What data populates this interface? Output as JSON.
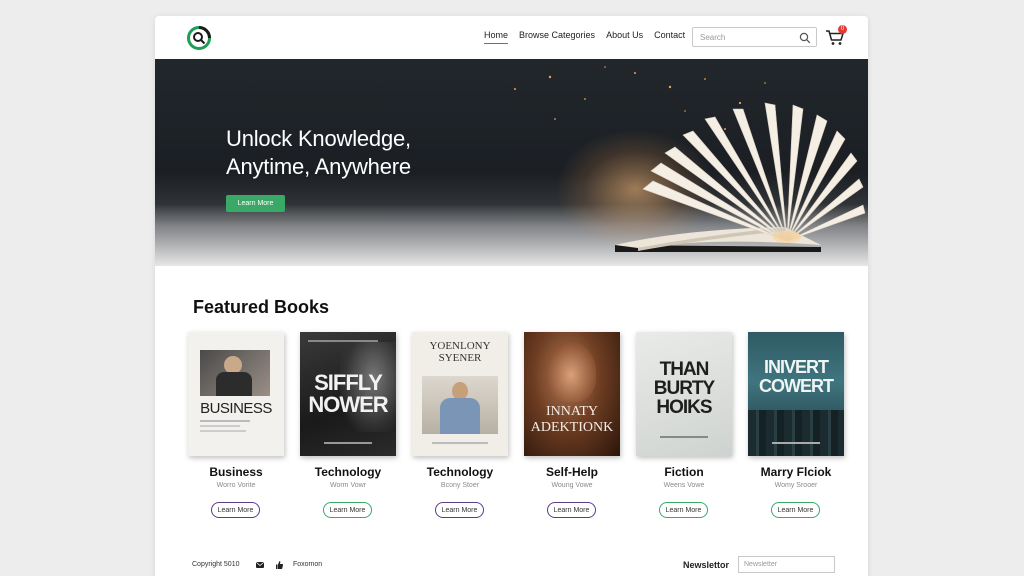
{
  "header": {
    "nav": [
      {
        "label": "Home",
        "active": true
      },
      {
        "label": "Browse Categories",
        "active": false
      },
      {
        "label": "About Us",
        "active": false
      },
      {
        "label": "Contact",
        "active": false
      }
    ],
    "search_placeholder": "Search",
    "cart_count": "0"
  },
  "hero": {
    "title_line1": "Unlock Knowledge,",
    "title_line2": "Anytime, Anywhere",
    "button_label": "Learn More"
  },
  "featured": {
    "title": "Featured Books",
    "books": [
      {
        "cover_text": "BUSINESS",
        "category": "Business",
        "author": "Worro Vorite",
        "button_label": "Learn More",
        "button_color": "#5b3d8a"
      },
      {
        "cover_text_line1": "SIFFLY",
        "cover_text_line2": "NOWER",
        "category": "Technology",
        "author": "Worm Vowr",
        "button_label": "Learn More",
        "button_color": "#3aa968"
      },
      {
        "cover_text_line1": "YOENLONY",
        "cover_text_line2": "SYENER",
        "category": "Technology",
        "author": "Bcony Stoer",
        "button_label": "Learn More",
        "button_color": "#5b3d8a"
      },
      {
        "cover_text_line1": "INNATY",
        "cover_text_line2": "ADEKTIONK",
        "category": "Self-Help",
        "author": "Woung Vowe",
        "button_label": "Learn More",
        "button_color": "#5b3d8a"
      },
      {
        "cover_text_line1": "THAN",
        "cover_text_line2": "BURTY",
        "cover_text_line3": "HOIKS",
        "category": "Fiction",
        "author": "Weens Vowe",
        "button_label": "Learn More",
        "button_color": "#3aa968"
      },
      {
        "cover_text_line1": "INIVERT",
        "cover_text_line2": "COWERT",
        "category": "Marry Flciok",
        "author": "Womy Srooer",
        "button_label": "Learn More",
        "button_color": "#3aa968"
      }
    ]
  },
  "footer": {
    "copyright": "Copyright 5010",
    "link": "Foxomon",
    "newsletter_label": "Newslettor",
    "newsletter_placeholder": "Newsletter"
  },
  "colors": {
    "accent_green": "#3aa968",
    "accent_purple": "#5b3d8a",
    "hero_dark": "#1b1f24"
  }
}
